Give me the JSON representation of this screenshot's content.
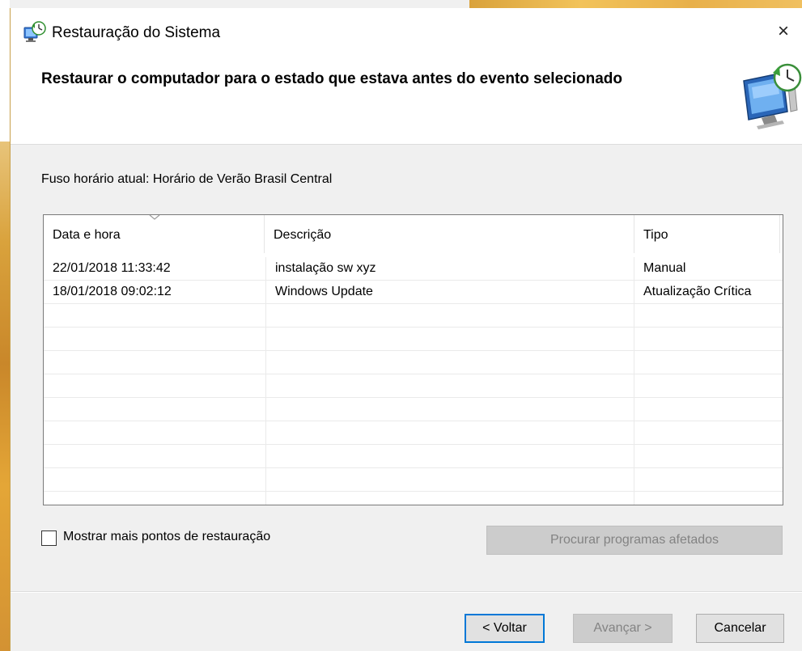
{
  "window": {
    "title": "Restauração do Sistema",
    "close_glyph": "×"
  },
  "header": {
    "instruction": "Restaurar o computador para o estado que estava antes do evento selecionado"
  },
  "timezone_text": "Fuso horário atual: Horário de Verão Brasil Central",
  "restore_points": {
    "columns": [
      "Data e hora",
      "Descrição",
      "Tipo"
    ],
    "rows": [
      {
        "date": "22/01/2018 11:33:42",
        "description": "instalação sw xyz",
        "type": "Manual"
      },
      {
        "date": "18/01/2018 09:02:12",
        "description": "Windows Update",
        "type": "Atualização Crítica"
      }
    ]
  },
  "show_more": {
    "label": "Mostrar mais pontos de restauração",
    "checked": false
  },
  "buttons": {
    "scan": "Procurar programas afetados",
    "back": "< Voltar",
    "next": "Avançar >",
    "cancel": "Cancelar"
  },
  "colors": {
    "accent": "#0078d7",
    "window_bg": "#f0f0f0",
    "header_bg": "#ffffff"
  },
  "icons": {
    "app": "system-restore-icon",
    "header": "monitor-restore-icon",
    "sort": "sort-descending-icon"
  }
}
